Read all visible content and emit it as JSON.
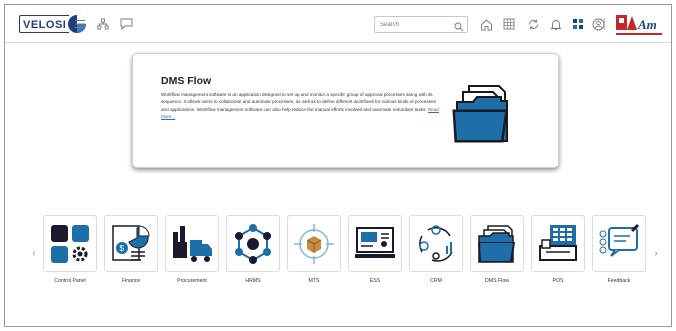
{
  "header": {
    "logo_text": "VELOSI",
    "search_placeholder": "Search",
    "icons": [
      "menu-icon",
      "org-chart-icon",
      "chat-icon",
      "search-icon",
      "home-icon",
      "grid-icon",
      "refresh-icon",
      "bell-icon",
      "apps-icon",
      "user-icon",
      "more-vertical-icon"
    ],
    "brand_logo_text": "PAM",
    "accent_color": "#1d3f7a"
  },
  "featured": {
    "title": "DMS Flow",
    "description": "Workflow management software is an application designed to set up and monitor a specific group of approval processes along with its sequence. It allows users to collaborate and automate processes, as well as to define different workflows for various kinds of processes and applications. Workflow management software can also help reduce the manual efforts involved and automate redundant tasks.",
    "read_more": "Read More..."
  },
  "modules": [
    {
      "label": "Control Panel",
      "icon": "control-panel-icon"
    },
    {
      "label": "Finance",
      "icon": "finance-icon"
    },
    {
      "label": "Procurement",
      "icon": "procurement-icon"
    },
    {
      "label": "HRMS",
      "icon": "hrms-icon"
    },
    {
      "label": "MTS",
      "icon": "mts-icon"
    },
    {
      "label": "ESS",
      "icon": "ess-icon"
    },
    {
      "label": "CRM",
      "icon": "crm-icon"
    },
    {
      "label": "DMS Flow",
      "icon": "dms-flow-icon"
    },
    {
      "label": "POS",
      "icon": "pos-icon"
    },
    {
      "label": "Feedback",
      "icon": "feedback-icon"
    }
  ],
  "carousel": {
    "prev_symbol": "‹",
    "next_symbol": "›"
  },
  "colors": {
    "primary": "#1e6fa8",
    "dark": "#1a1a2e",
    "muted": "#9a9a9a"
  }
}
